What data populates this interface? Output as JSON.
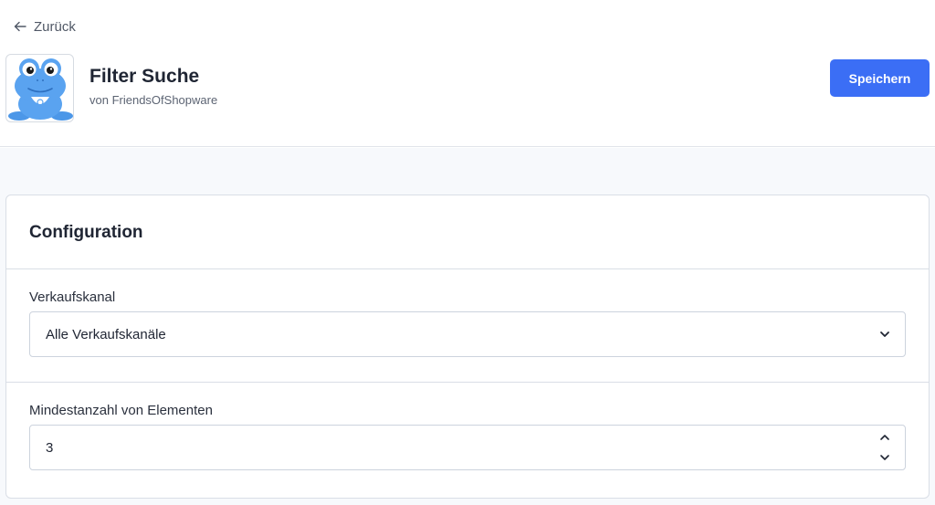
{
  "header": {
    "back_label": "Zurück",
    "app_title": "Filter Suche",
    "app_vendor": "von FriendsOfShopware",
    "save_label": "Speichern",
    "accent_color": "#3b6ef5"
  },
  "card": {
    "title": "Configuration",
    "fields": [
      {
        "label": "Verkaufskanal",
        "type": "select",
        "value": "Alle Verkaufskanäle",
        "icon": "chevron-down-icon"
      },
      {
        "label": "Mindestanzahl von Elementen",
        "type": "number",
        "value": "3",
        "icons": [
          "chevron-up-icon",
          "chevron-down-icon"
        ]
      }
    ]
  },
  "icons": {
    "back": "arrow-left-icon",
    "app": "frog-logo-icon"
  }
}
